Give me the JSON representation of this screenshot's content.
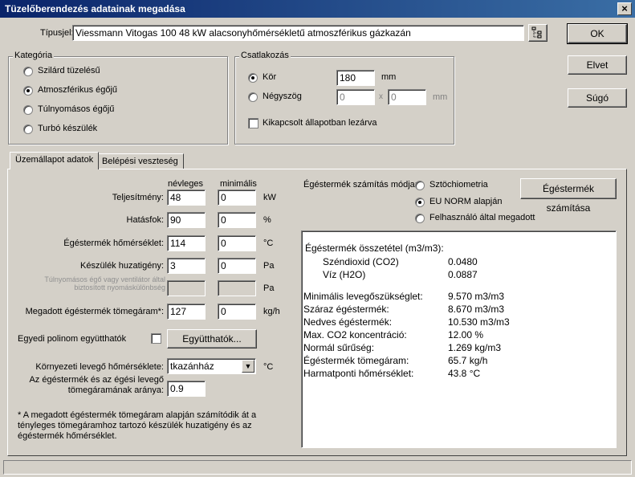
{
  "window": {
    "title": "Tüzelőberendezés adatainak megadása",
    "close": "×"
  },
  "tipusjel": {
    "label": "Típusjel:",
    "value": "Viessmann Vitogas 100 48 kW alacsonyhőmérsékletű atmoszférikus gázkazán"
  },
  "buttons": {
    "ok": "OK",
    "cancel": "Elvet",
    "help": "Súgó"
  },
  "kategoria": {
    "title": "Kategória",
    "options": [
      "Szilárd tüzelésű",
      "Atmoszférikus égőjű",
      "Túlnyomásos égőjű",
      "Turbó készülék"
    ],
    "selected": 1
  },
  "csatlakozas": {
    "title": "Csatlakozás",
    "kor": {
      "label": "Kör",
      "value": "180",
      "unit": "mm"
    },
    "negyszog": {
      "label": "Négyszög",
      "value1": "0",
      "x": "x",
      "value2": "0",
      "unit": "mm"
    },
    "kikapcsolt": "Kikapcsolt állapotban lezárva"
  },
  "tabs": [
    "Üzemállapot adatok",
    "Belépési veszteség"
  ],
  "params": {
    "col_nevleges": "névleges",
    "col_minimalis": "minimális",
    "rows": [
      {
        "label": "Teljesítmény:",
        "nom": "48",
        "min": "0",
        "unit": "kW"
      },
      {
        "label": "Hatásfok:",
        "nom": "90",
        "min": "0",
        "unit": "%"
      },
      {
        "label": "Égéstermék hőmérséklet:",
        "nom": "114",
        "min": "0",
        "unit": "°C"
      },
      {
        "label": "Készülék huzatigény:",
        "nom": "3",
        "min": "0",
        "unit": "Pa"
      },
      {
        "label": "Túlnyomásos égő vagy ventilátor által biztosított nyomáskülönbség",
        "nom": "",
        "min": "",
        "unit": "Pa"
      },
      {
        "label": "Megadott égéstermék tömegáram*:",
        "nom": "127",
        "min": "0",
        "unit": "kg/h"
      }
    ],
    "polinom_label": "Egyedi polinom együtthatók",
    "polinom_button": "Együtthatók...",
    "kornyezeti_label": "Környezeti levegő hőmérséklete:",
    "kornyezeti_value": "tkazánház",
    "kornyezeti_unit": "°C",
    "arany_label_1": "Az égéstermék és az égési levegő",
    "arany_label_2": "tömegáramának aránya:",
    "arany_value": "0.9",
    "footnote": "* A megadott égéstermék tömegáram alapján számítódik át a tényleges tömegáramhoz tartozó készülék huzatigény és az égéstermék hőmérséklet."
  },
  "szamitas": {
    "mode_label": "Égéstermék számítás módja:",
    "options": [
      "Sztöchiometria",
      "EU NORM alapján",
      "Felhasználó által megadott"
    ],
    "selected": 1,
    "button": "Égéstermék számítása"
  },
  "results": {
    "heading": "Égéstermék összetétel (m3/m3):",
    "composition": [
      {
        "label": "Széndioxid (CO2)",
        "value": "0.0480"
      },
      {
        "label": "Víz (H2O)",
        "value": "0.0887"
      }
    ],
    "rows": [
      {
        "label": "Minimális levegőszükséglet:",
        "value": "9.570 m3/m3"
      },
      {
        "label": "Száraz égéstermék:",
        "value": "8.670 m3/m3"
      },
      {
        "label": "Nedves égéstermék:",
        "value": "10.530 m3/m3"
      },
      {
        "label": "Max. CO2 koncentráció:",
        "value": "12.00 %"
      },
      {
        "label": "Normál sűrűség:",
        "value": "1.269 kg/m3"
      },
      {
        "label": "Égéstermék tömegáram:",
        "value": "65.7 kg/h"
      },
      {
        "label": "Harmatponti hőmérséklet:",
        "value": "43.8 °C"
      }
    ]
  }
}
